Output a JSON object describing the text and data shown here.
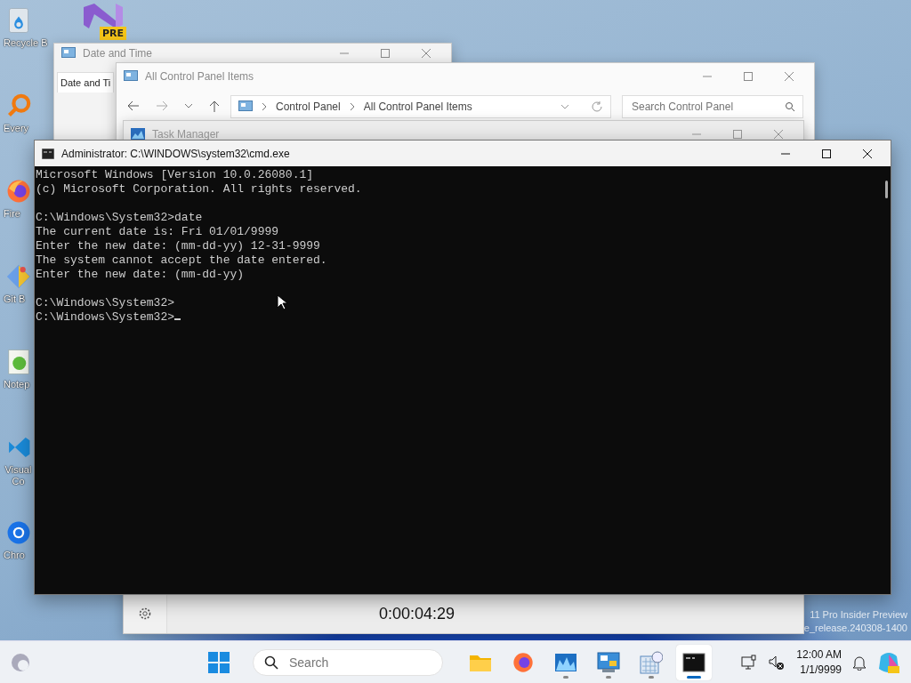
{
  "desktop_icons": [
    {
      "label": "Recycle B",
      "kind": "recycle"
    },
    {
      "label": "Every",
      "kind": "search"
    },
    {
      "label": "Fire",
      "kind": "firefox"
    },
    {
      "label": "Git B",
      "kind": "git"
    },
    {
      "label": "Notep",
      "kind": "notepad"
    },
    {
      "label": "Visual Co",
      "kind": "vscode"
    },
    {
      "label": "Chro",
      "kind": "chrome"
    }
  ],
  "preview_badge": "PRE",
  "watermark": [
    "11 Pro Insider Preview",
    "e_release.240308-1400"
  ],
  "date_time_window": {
    "title": "Date and Time",
    "tabs": [
      {
        "label": "Date and Ti",
        "selected": true
      }
    ]
  },
  "control_panel_window": {
    "title": "All Control Panel Items",
    "breadcrumb": [
      "Control Panel",
      "All Control Panel Items"
    ],
    "search": {
      "placeholder": "Search Control Panel"
    }
  },
  "task_manager_window": {
    "title": "Task Manager",
    "elapsed": "0:00:04:29"
  },
  "cmd_window": {
    "title": "Administrator: C:\\WINDOWS\\system32\\cmd.exe",
    "blocks": [
      [
        "Microsoft Windows [Version 10.0.26080.1]",
        "(c) Microsoft Corporation. All rights reserved."
      ],
      [
        "C:\\Windows\\System32>date",
        "The current date is: Fri 01/01/9999",
        "Enter the new date: (mm-dd-yy) 12-31-9999",
        "The system cannot accept the date entered.",
        "Enter the new date: (mm-dd-yy)"
      ],
      [
        "C:\\Windows\\System32>",
        "C:\\Windows\\System32>"
      ]
    ]
  },
  "taskbar": {
    "search": {
      "placeholder": "Search"
    },
    "apps": [
      {
        "kind": "explorer",
        "running": false,
        "active": false
      },
      {
        "kind": "firefox",
        "running": false,
        "active": false
      },
      {
        "kind": "monitor",
        "running": true,
        "active": false
      },
      {
        "kind": "controlpanel",
        "running": true,
        "active": false
      },
      {
        "kind": "datetime",
        "running": true,
        "active": false
      },
      {
        "kind": "terminal",
        "running": true,
        "active": true
      }
    ],
    "clock": {
      "time": "12:00 AM",
      "date": "1/1/9999"
    }
  }
}
